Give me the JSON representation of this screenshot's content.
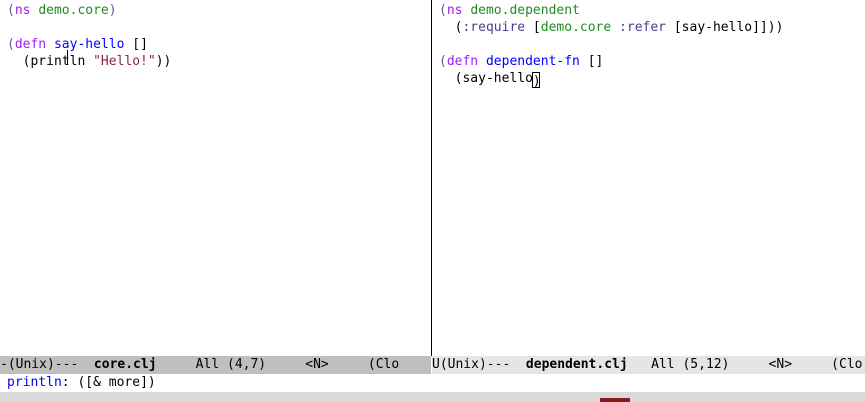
{
  "left_pane": {
    "lines": [
      {
        "tokens": [
          [
            "(",
            "p"
          ],
          [
            "ns",
            "k"
          ],
          [
            " ",
            ""
          ],
          [
            "demo.core",
            "ns"
          ],
          [
            ")",
            "p"
          ]
        ]
      },
      {
        "tokens": []
      },
      {
        "tokens": [
          [
            "(",
            "p"
          ],
          [
            "defn",
            "k"
          ],
          [
            " ",
            ""
          ],
          [
            "say-hello",
            "fn"
          ],
          [
            " []",
            ""
          ]
        ]
      },
      {
        "tokens": [
          [
            "  (println ",
            ""
          ],
          [
            "\"Hello!\"",
            "st"
          ],
          [
            "))",
            ""
          ]
        ]
      }
    ]
  },
  "right_pane": {
    "lines": [
      {
        "tokens": [
          [
            "(",
            "p"
          ],
          [
            "ns",
            "k"
          ],
          [
            " ",
            ""
          ],
          [
            "demo.dependent",
            "ns"
          ]
        ]
      },
      {
        "tokens": [
          [
            "  (",
            ""
          ],
          [
            ":require",
            "kw"
          ],
          [
            " [",
            ""
          ],
          [
            "demo.core",
            "ns"
          ],
          [
            " ",
            ""
          ],
          [
            ":refer",
            "kw"
          ],
          [
            " [say-hello]]))",
            ""
          ]
        ]
      },
      {
        "tokens": []
      },
      {
        "tokens": [
          [
            "(",
            "p"
          ],
          [
            "defn",
            "k"
          ],
          [
            " ",
            ""
          ],
          [
            "dependent-fn",
            "fn"
          ],
          [
            " []",
            ""
          ]
        ]
      },
      {
        "tokens": [
          [
            "  (say-hello",
            ""
          ],
          [
            ")",
            "cursor"
          ]
        ]
      }
    ]
  },
  "modeline_left": {
    "prefix": "-(Unix)---  ",
    "file": "core.clj",
    "position": "     All (4,7)     <N>     (Clo"
  },
  "modeline_right": {
    "prefix": "U(Unix)---  ",
    "file": "dependent.clj",
    "position": "   All (5,12)     <N>     (Clo"
  },
  "minibuffer": {
    "fn": "println",
    "rest": ": ([& more])"
  }
}
